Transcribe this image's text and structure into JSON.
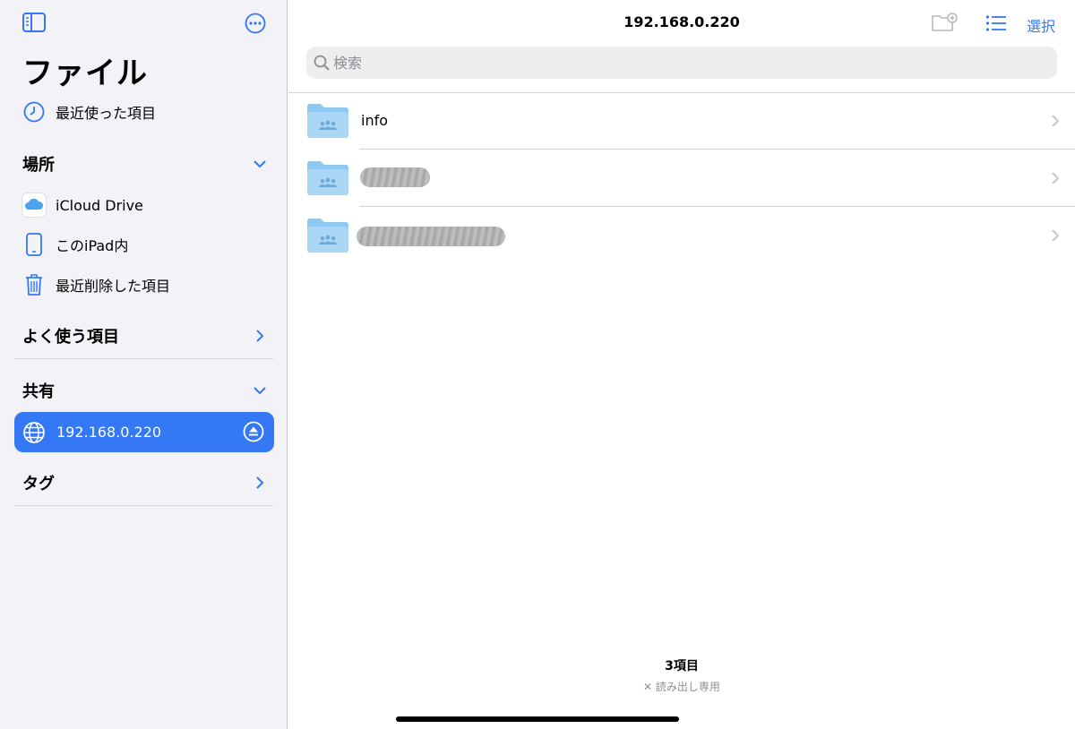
{
  "sidebar": {
    "title": "ファイル",
    "recents_label": "最近使った項目",
    "locations": {
      "heading": "場所",
      "items": [
        {
          "label": "iCloud Drive",
          "icon": "icloud-icon"
        },
        {
          "label": "このiPad内",
          "icon": "ipad-icon"
        },
        {
          "label": "最近削除した項目",
          "icon": "trash-icon"
        }
      ]
    },
    "favorites": {
      "heading": "よく使う項目"
    },
    "shared": {
      "heading": "共有",
      "items": [
        {
          "label": "192.168.0.220",
          "icon": "globe-icon",
          "selected": true
        }
      ]
    },
    "tags": {
      "heading": "タグ"
    }
  },
  "main": {
    "title": "192.168.0.220",
    "select_label": "選択",
    "search": {
      "placeholder": "検索",
      "value": ""
    },
    "files": [
      {
        "name": "info",
        "redacted": false
      },
      {
        "name": "",
        "redacted": true
      },
      {
        "name": "",
        "redacted": true
      }
    ],
    "count_label": "3項目",
    "readonly_label": "読み出し専用"
  },
  "colors": {
    "accent": "#3478f6",
    "sidebar_bg": "#f2f2f7",
    "folder": "#a9d6f5"
  }
}
